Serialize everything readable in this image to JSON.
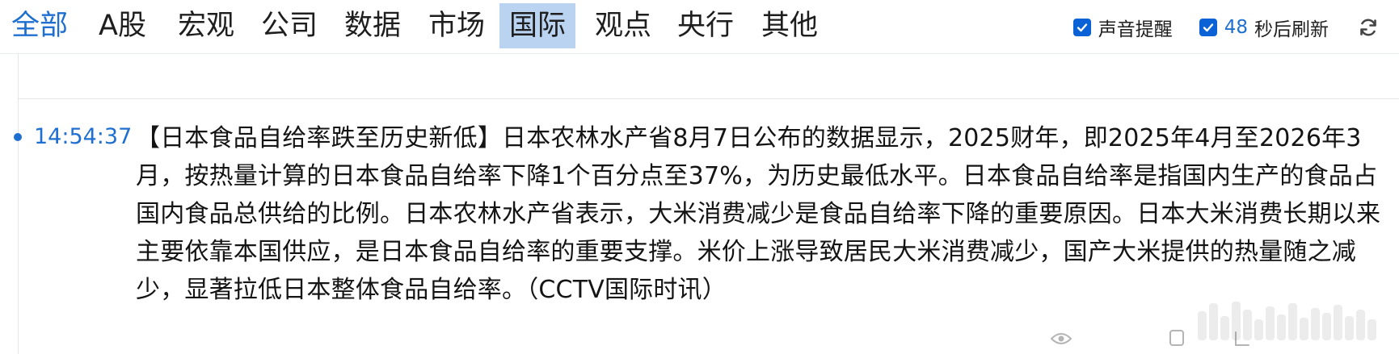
{
  "tabs": [
    {
      "label": "全部",
      "state": "active"
    },
    {
      "label": "A股",
      "state": "normal"
    },
    {
      "label": "宏观",
      "state": "normal"
    },
    {
      "label": "公司",
      "state": "normal"
    },
    {
      "label": "数据",
      "state": "normal"
    },
    {
      "label": "市场",
      "state": "normal"
    },
    {
      "label": "国际",
      "state": "highlighted"
    },
    {
      "label": "观点",
      "state": "normal"
    },
    {
      "label": "央行",
      "state": "normal"
    },
    {
      "label": "其他",
      "state": "normal"
    }
  ],
  "options": {
    "sound_alert_label": "声音提醒",
    "sound_alert_checked": true,
    "auto_refresh_checked": true,
    "refresh_countdown": "48",
    "refresh_suffix": "秒后刷新",
    "refresh_icon": "refresh-icon"
  },
  "news": {
    "time": "14:54:37",
    "content": "【日本食品自给率跌至历史新低】日本农林水产省8月7日公布的数据显示，2025财年，即2025年4月至2026年3月，按热量计算的日本食品自给率下降1个百分点至37%，为历史最低水平。日本食品自给率是指国内生产的食品占国内食品总供给的比例。日本农林水产省表示，大米消费减少是食品自给率下降的重要原因。日本大米消费长期以来主要依靠本国供应，是日本食品自给率的重要支撑。米价上涨导致居民大米消费减少，国产大米提供的热量随之减少，显著拉低日本整体食品自给率。（CCTV国际时讯）"
  },
  "colors": {
    "accent": "#1f6fd1",
    "highlight_bg": "#b9d3f1",
    "checkbox": "#0b62d6"
  },
  "icons": {
    "views": "eye-icon",
    "comment": "comment-icon",
    "share": "share-icon"
  }
}
